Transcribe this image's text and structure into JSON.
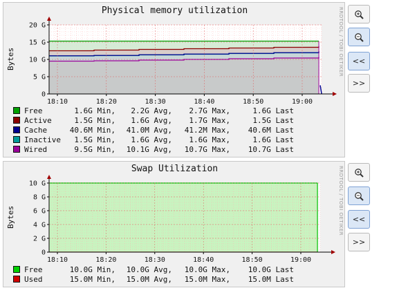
{
  "graphs": [
    {
      "id": "mem",
      "title": "Physical memory utilization",
      "ylabel": "Bytes",
      "watermark": "RRDTOOL / TOBI OETIKER",
      "y_ticks": [
        "0",
        "5 G",
        "10 G",
        "15 G",
        "20 G"
      ],
      "x_ticks": [
        "18:10",
        "18:20",
        "18:30",
        "18:40",
        "18:50",
        "19:00"
      ],
      "legend": [
        {
          "name": "Free",
          "color": "#00a000",
          "min": "1.6G Min,",
          "avg": "2.2G Avg,",
          "max": "2.7G Max,",
          "last": "1.6G Last"
        },
        {
          "name": "Active",
          "color": "#8b0000",
          "min": "1.5G Min,",
          "avg": "1.6G Avg,",
          "max": "1.7G Max,",
          "last": "1.5G Last"
        },
        {
          "name": "Cache",
          "color": "#000090",
          "min": "40.6M Min,",
          "avg": "41.0M Avg,",
          "max": "41.2M Max,",
          "last": "40.6M Last"
        },
        {
          "name": "Inactive",
          "color": "#009a9a",
          "min": "1.5G Min,",
          "avg": "1.6G Avg,",
          "max": "1.6G Max,",
          "last": "1.6G Last"
        },
        {
          "name": "Wired",
          "color": "#9a009a",
          "min": "9.5G Min,",
          "avg": "10.1G Avg,",
          "max": "10.7G Max,",
          "last": "10.7G Last"
        }
      ]
    },
    {
      "id": "swap",
      "title": "Swap Utilization",
      "ylabel": "Bytes",
      "watermark": "RRDTOOL / TOBI OETIKER",
      "y_ticks": [
        "0",
        "2 G",
        "4 G",
        "6 G",
        "8 G",
        "10 G"
      ],
      "x_ticks": [
        "18:10",
        "18:20",
        "18:30",
        "18:40",
        "18:50",
        "19:00"
      ],
      "legend": [
        {
          "name": "Free",
          "color": "#00d000",
          "min": "10.0G Min,",
          "avg": "10.0G Avg,",
          "max": "10.0G Max,",
          "last": "10.0G Last"
        },
        {
          "name": "Used",
          "color": "#d00000",
          "min": "15.0M Min,",
          "avg": "15.0M Avg,",
          "max": "15.0M Max,",
          "last": "15.0M Last"
        }
      ]
    }
  ],
  "controls": {
    "zoom_in": "zoom-in",
    "zoom_out": "zoom-out",
    "back": "<<",
    "forward": ">>"
  },
  "chart_data": [
    {
      "type": "area",
      "title": "Physical memory utilization",
      "ylabel": "Bytes",
      "x_ticks": [
        "18:10",
        "18:20",
        "18:30",
        "18:40",
        "18:50",
        "19:00"
      ],
      "ylim_gb": [
        0,
        20
      ],
      "series": [
        {
          "name": "Wired",
          "values_gb": [
            9.5,
            9.6,
            9.8,
            10.0,
            10.2,
            10.4,
            10.7
          ]
        },
        {
          "name": "Inactive",
          "values_gb": [
            11.0,
            11.1,
            11.3,
            11.5,
            11.7,
            11.9,
            12.3
          ]
        },
        {
          "name": "Cache",
          "values_gb": [
            11.05,
            11.15,
            11.35,
            11.55,
            11.75,
            11.95,
            12.35
          ]
        },
        {
          "name": "Active",
          "values_gb": [
            12.5,
            12.7,
            12.9,
            13.1,
            13.3,
            13.5,
            13.8
          ]
        },
        {
          "name": "Free",
          "values_gb": [
            15.3,
            15.3,
            15.3,
            15.3,
            15.3,
            15.3,
            15.3
          ]
        }
      ]
    },
    {
      "type": "area",
      "title": "Swap Utilization",
      "ylabel": "Bytes",
      "x_ticks": [
        "18:10",
        "18:20",
        "18:30",
        "18:40",
        "18:50",
        "19:00"
      ],
      "ylim_gb": [
        0,
        10
      ],
      "series": [
        {
          "name": "Free",
          "values_gb": [
            10.0,
            10.0,
            10.0,
            10.0,
            10.0,
            10.0,
            10.0
          ]
        },
        {
          "name": "Used",
          "values_gb": [
            0.015,
            0.015,
            0.015,
            0.015,
            0.015,
            0.015,
            0.015
          ]
        }
      ]
    }
  ]
}
